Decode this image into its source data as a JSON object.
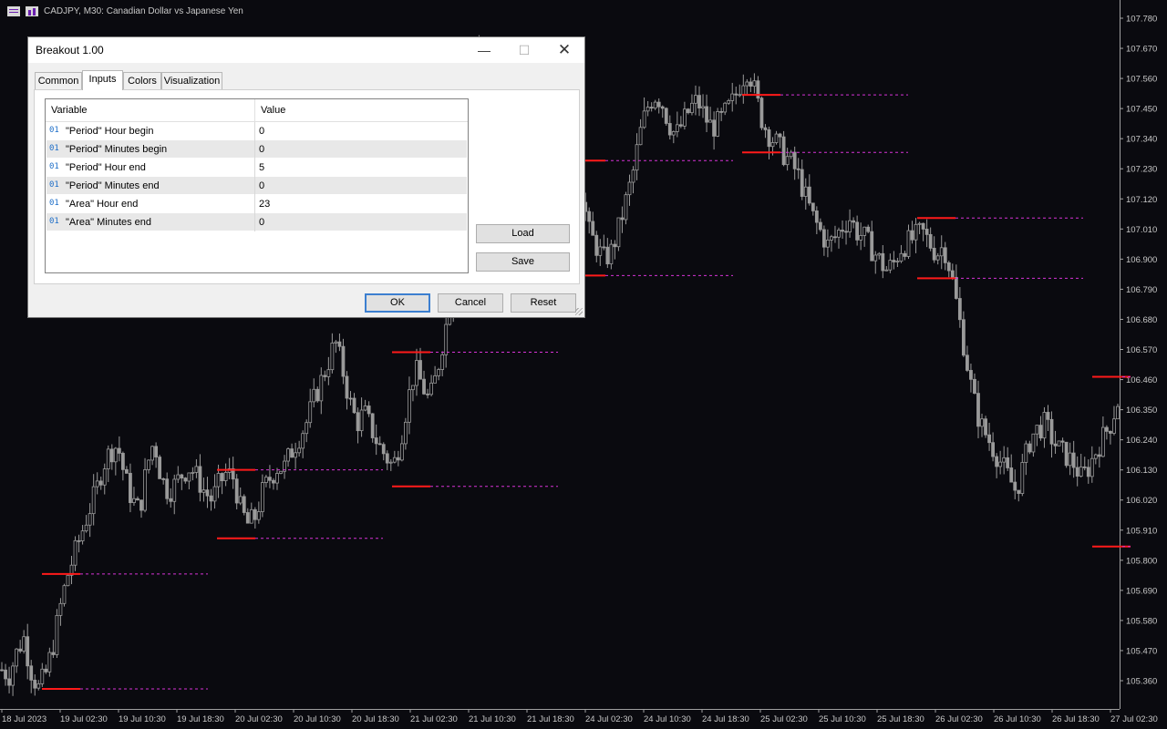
{
  "chart_header": {
    "title": "CADJPY, M30:  Canadian Dollar vs Japanese Yen",
    "icons": [
      "chart-list-icon",
      "chart-window-icon"
    ]
  },
  "chart_data": {
    "type": "candlestick",
    "symbol": "CADJPY",
    "timeframe": "M30",
    "ylim": [
      105.25,
      107.83
    ],
    "y_ticks": [
      "107.780",
      "107.670",
      "107.560",
      "107.450",
      "107.340",
      "107.230",
      "107.120",
      "107.010",
      "106.900",
      "106.790",
      "106.680",
      "106.570",
      "106.460",
      "106.350",
      "106.240",
      "106.130",
      "106.020",
      "105.910",
      "105.800",
      "105.690",
      "105.580",
      "105.470",
      "105.360"
    ],
    "x_ticks": [
      "18 Jul 2023",
      "19 Jul 02:30",
      "19 Jul 10:30",
      "19 Jul 18:30",
      "20 Jul 02:30",
      "20 Jul 10:30",
      "20 Jul 18:30",
      "21 Jul 02:30",
      "21 Jul 10:30",
      "21 Jul 18:30",
      "24 Jul 02:30",
      "24 Jul 10:30",
      "24 Jul 18:30",
      "25 Jul 02:30",
      "25 Jul 10:30",
      "25 Jul 18:30",
      "26 Jul 02:30",
      "26 Jul 10:30",
      "26 Jul 18:30",
      "27 Jul 02:30"
    ],
    "price_path": [
      105.4,
      105.38,
      105.46,
      105.52,
      105.4,
      105.33,
      105.38,
      105.48,
      105.62,
      105.74,
      105.82,
      105.9,
      105.98,
      106.05,
      106.15,
      106.2,
      106.22,
      106.1,
      106.02,
      105.98,
      106.14,
      106.24,
      106.1,
      106.05,
      106.08,
      106.12,
      106.14,
      106.1,
      106.05,
      106.02,
      106.08,
      106.12,
      106.1,
      105.98,
      105.93,
      105.96,
      106.05,
      106.1,
      106.14,
      106.14,
      106.2,
      106.25,
      106.3,
      106.38,
      106.45,
      106.52,
      106.6,
      106.5,
      106.38,
      106.3,
      106.34,
      106.28,
      106.22,
      106.18,
      106.14,
      106.24,
      106.38,
      106.5,
      106.44,
      106.38,
      106.48,
      106.62,
      106.75,
      106.95,
      107.25,
      107.55,
      107.7,
      107.6,
      107.45,
      107.3,
      107.2,
      107.15,
      107.1,
      107.05,
      107.0,
      106.95,
      106.9,
      106.95,
      107.05,
      107.1,
      107.15,
      107.0,
      106.95,
      106.9,
      106.92,
      107.0,
      107.1,
      107.2,
      107.35,
      107.45,
      107.5,
      107.48,
      107.4,
      107.35,
      107.4,
      107.45,
      107.48,
      107.42,
      107.38,
      107.4,
      107.44,
      107.48,
      107.55,
      107.6,
      107.5,
      107.4,
      107.35,
      107.32,
      107.28,
      107.25,
      107.2,
      107.12,
      107.05,
      107.0,
      106.95,
      106.98,
      107.02,
      107.05,
      107.0,
      106.98,
      106.94,
      106.9,
      106.86,
      106.88,
      106.94,
      106.96,
      106.98,
      107.0,
      106.96,
      106.92,
      106.95,
      106.85,
      106.7,
      106.55,
      106.4,
      106.3,
      106.25,
      106.2,
      106.15,
      106.1,
      106.05,
      106.15,
      106.25,
      106.28,
      106.3,
      106.24,
      106.2,
      106.18,
      106.15,
      106.1,
      106.14,
      106.2,
      106.25,
      106.3,
      106.38
    ],
    "breakout_levels": [
      {
        "period": 1,
        "high": 105.75,
        "low": 105.33
      },
      {
        "period": 2,
        "high": 106.13,
        "low": 105.88
      },
      {
        "period": 3,
        "high": 106.56,
        "low": 106.07
      },
      {
        "period": 4,
        "high": 107.26,
        "low": 106.84
      },
      {
        "period": 5,
        "high": 107.5,
        "low": 107.29
      },
      {
        "period": 6,
        "high": 107.05,
        "low": 106.83
      },
      {
        "period": 7,
        "high": 106.47,
        "low": 105.85
      }
    ],
    "colors": {
      "background": "#0a0a0f",
      "candles": "#9a9a9a",
      "level_period": "#ff1a1a",
      "level_projection": "#d633d6",
      "axis_text": "#c8c8c8",
      "axis_line": "#a0a0a0"
    }
  },
  "dialog": {
    "title": "Breakout 1.00",
    "window_buttons": {
      "minimize": "—",
      "maximize": "☐",
      "close": "✕"
    },
    "tabs": [
      {
        "label": "Common",
        "active": false
      },
      {
        "label": "Inputs",
        "active": true
      },
      {
        "label": "Colors",
        "active": false
      },
      {
        "label": "Visualization",
        "active": false
      }
    ],
    "grid": {
      "headers": {
        "variable": "Variable",
        "value": "Value"
      },
      "type_icon": "01",
      "rows": [
        {
          "variable": "\"Period\" Hour begin",
          "value": "0"
        },
        {
          "variable": "\"Period\" Minutes begin",
          "value": "0"
        },
        {
          "variable": "\"Period\" Hour end",
          "value": "5"
        },
        {
          "variable": "\"Period\" Minutes end",
          "value": "0"
        },
        {
          "variable": "\"Area\" Hour end",
          "value": "23"
        },
        {
          "variable": "\"Area\" Minutes end",
          "value": "0"
        }
      ]
    },
    "side_buttons": {
      "load": "Load",
      "save": "Save"
    },
    "footer_buttons": {
      "ok": "OK",
      "cancel": "Cancel",
      "reset": "Reset"
    }
  }
}
